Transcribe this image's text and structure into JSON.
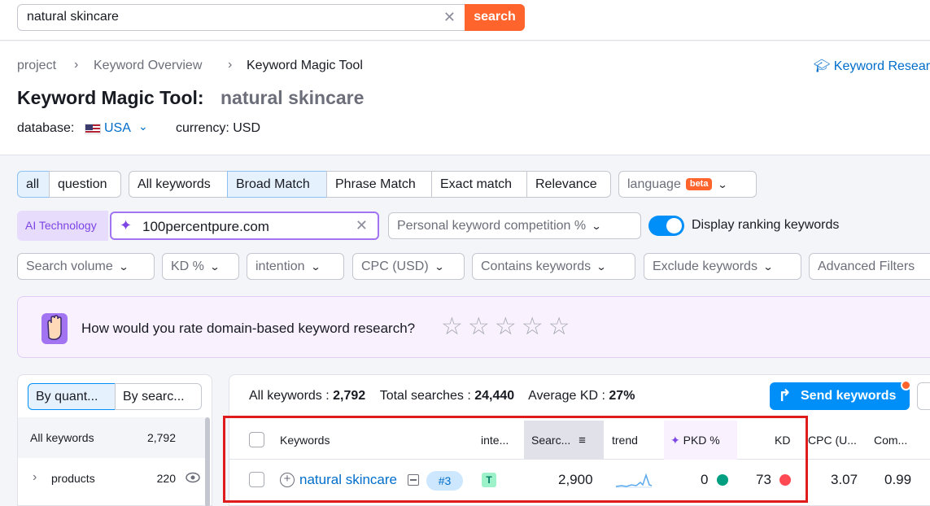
{
  "search": {
    "value": "natural skincare",
    "button": "search"
  },
  "breadcrumb": {
    "items": [
      "project",
      "Keyword Overview",
      "Keyword Magic Tool"
    ]
  },
  "header": {
    "title": "Keyword Magic Tool:",
    "query": "natural skincare",
    "database_label": "database:",
    "database_value": "USA",
    "currency_label": "currency: USD",
    "research_link": "Keyword Research"
  },
  "filters": {
    "all": "all",
    "question": "question",
    "all_keywords": "All keywords",
    "broad_match": "Broad Match",
    "phrase_match": "Phrase Match",
    "exact_match": "Exact match",
    "relevance": "Relevance",
    "language": "language",
    "beta": "beta",
    "ai_badge": "AI Technology",
    "domain": "100percentpure.com",
    "pkc": "Personal keyword competition %",
    "toggle_label": "Display ranking keywords",
    "search_volume": "Search volume",
    "kd": "KD %",
    "intention": "intention",
    "cpc": "CPC (USD)",
    "contains": "Contains keywords",
    "exclude": "Exclude keywords",
    "advanced": "Advanced Filters"
  },
  "banner": {
    "question": "How would you rate domain-based keyword research?",
    "stars": 5
  },
  "left_panel": {
    "tab1": "By quant...",
    "tab2": "By searc...",
    "rows": [
      {
        "name": "All keywords",
        "count": "2,792"
      },
      {
        "name": "products",
        "count": "220"
      }
    ]
  },
  "summary": {
    "all_label": "All keywords :",
    "all_value": "2,792",
    "total_label": "Total searches :",
    "total_value": "24,440",
    "avg_label": "Average KD :",
    "avg_value": "27%"
  },
  "send_button": "Send keywords",
  "table": {
    "headers": {
      "keywords": "Keywords",
      "intent": "inte...",
      "search": "Searc...",
      "trend": "trend",
      "pkd": "PKD %",
      "kd": "KD",
      "cpc": "CPC (U...",
      "com": "Com..."
    },
    "row": {
      "keyword": "natural skincare",
      "serp": "#3",
      "intent": "T",
      "volume": "2,900",
      "pkd": "0",
      "kd": "73",
      "cpc": "3.07",
      "com": "0.99"
    }
  },
  "colors": {
    "accent": "#008ff8",
    "search_btn": "#ff642d",
    "pkd_dot": "#009f81",
    "kd_dot": "#ff4953",
    "highlight": "#e01b1b"
  }
}
